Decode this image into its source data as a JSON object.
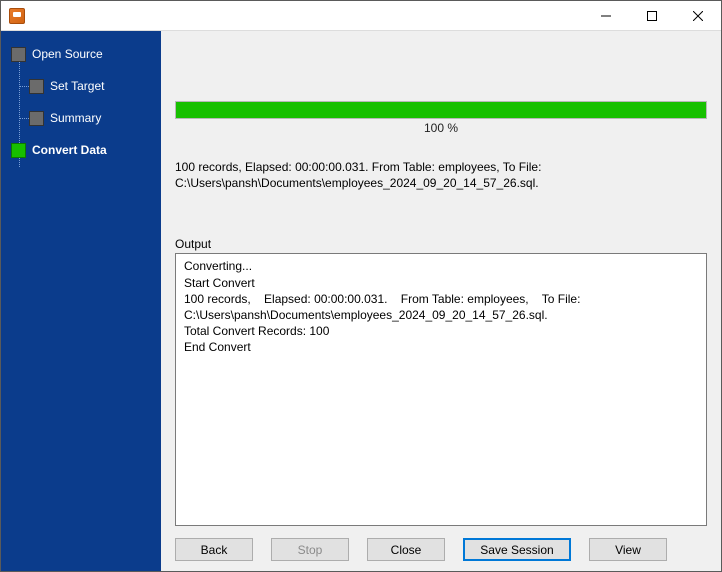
{
  "sidebar": {
    "items": [
      {
        "label": "Open Source",
        "active": false
      },
      {
        "label": "Set Target",
        "active": false
      },
      {
        "label": "Summary",
        "active": false
      },
      {
        "label": "Convert Data",
        "active": true
      }
    ]
  },
  "progress": {
    "percent_label": "100 %",
    "percent_value": 100
  },
  "status_line1": "100 records,    Elapsed: 00:00:00.031.    From Table: employees,    To File:",
  "status_line2": "C:\\Users\\pansh\\Documents\\employees_2024_09_20_14_57_26.sql.",
  "output": {
    "label": "Output",
    "text": "Converting...\nStart Convert\n100 records,    Elapsed: 00:00:00.031.    From Table: employees,    To File: C:\\Users\\pansh\\Documents\\employees_2024_09_20_14_57_26.sql.\nTotal Convert Records: 100\nEnd Convert"
  },
  "buttons": {
    "back": "Back",
    "stop": "Stop",
    "close": "Close",
    "save_session": "Save Session",
    "view": "View"
  }
}
